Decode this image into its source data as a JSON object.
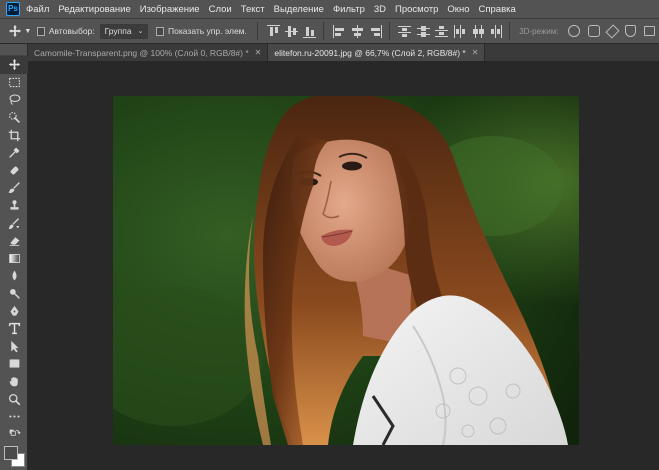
{
  "app": {
    "logo_text": "Ps"
  },
  "menu": {
    "items": [
      "Файл",
      "Редактирование",
      "Изображение",
      "Слои",
      "Текст",
      "Выделение",
      "Фильтр",
      "3D",
      "Просмотр",
      "Окно",
      "Справка"
    ]
  },
  "options": {
    "auto_select_label": "Автовыбор:",
    "auto_select_value": "Группа",
    "show_controls_label": "Показать упр. элем.",
    "mode_3d_label": "3D-режим:"
  },
  "tabs": [
    {
      "label": "Camomile-Transparent.png @ 100% (Слой 0, RGB/8#) *",
      "active": false
    },
    {
      "label": "elitefon.ru-20091.jpg @ 66,7% (Слой 2, RGB/8#) *",
      "active": true
    }
  ],
  "tools": [
    "move-tool",
    "marquee-tool",
    "lasso-tool",
    "quick-select-tool",
    "crop-tool",
    "eyedropper-tool",
    "healing-brush-tool",
    "brush-tool",
    "clone-stamp-tool",
    "history-brush-tool",
    "eraser-tool",
    "gradient-tool",
    "blur-tool",
    "dodge-tool",
    "pen-tool",
    "type-tool",
    "path-selection-tool",
    "rectangle-tool",
    "hand-tool",
    "zoom-tool",
    "more-tools"
  ],
  "colors": {
    "foreground": "#4a4a4a",
    "background": "#ffffff",
    "accent": "#31a8ff"
  }
}
